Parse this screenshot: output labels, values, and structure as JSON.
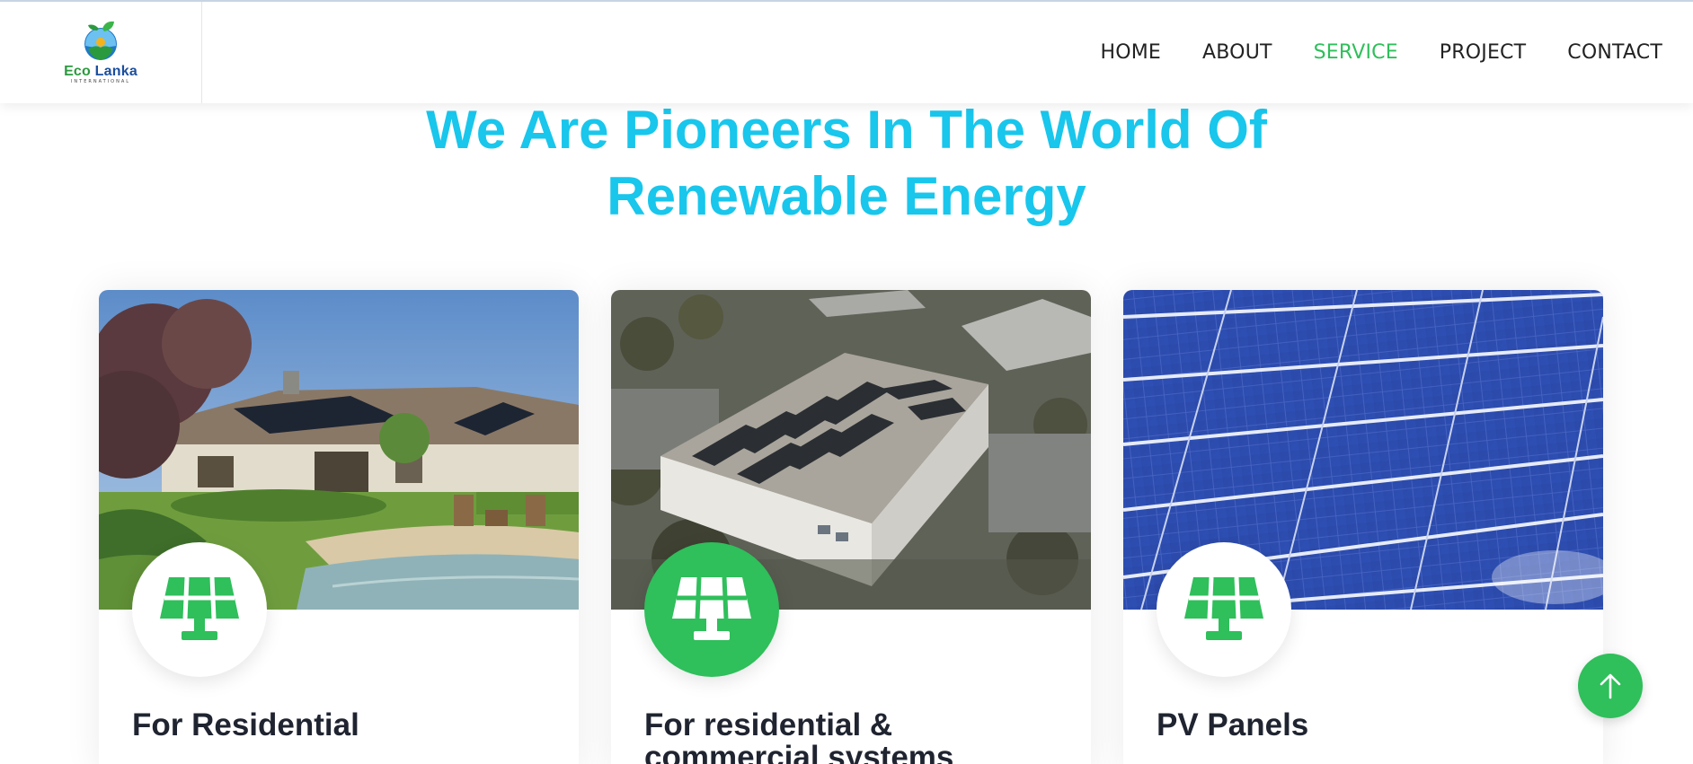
{
  "brand": {
    "name_part1": "Eco",
    "name_part2": "Lanka",
    "subtitle": "INTERNATIONAL"
  },
  "nav": {
    "items": [
      {
        "label": "HOME",
        "active": false
      },
      {
        "label": "ABOUT",
        "active": false
      },
      {
        "label": "SERVICE",
        "active": true
      },
      {
        "label": "PROJECT",
        "active": false
      },
      {
        "label": "CONTACT",
        "active": false
      }
    ]
  },
  "hero": {
    "title_line1": "We Are Pioneers In The World Of",
    "title_line2": "Renewable Energy"
  },
  "cards": [
    {
      "title": "For Residential",
      "icon": "solar-panel-icon",
      "image": "residential-house-with-rooftop-solar"
    },
    {
      "title": "For residential & commercial systems",
      "icon": "solar-panel-icon",
      "image": "aerial-commercial-rooftop-solar"
    },
    {
      "title": "PV Panels",
      "icon": "solar-panel-icon",
      "image": "blue-pv-panel-closeup"
    }
  ],
  "colors": {
    "accent_green": "#2fbf5b",
    "heading_cyan": "#19c6ec",
    "text_dark": "#1f2430"
  },
  "back_to_top": {
    "icon": "arrow-up-icon"
  }
}
